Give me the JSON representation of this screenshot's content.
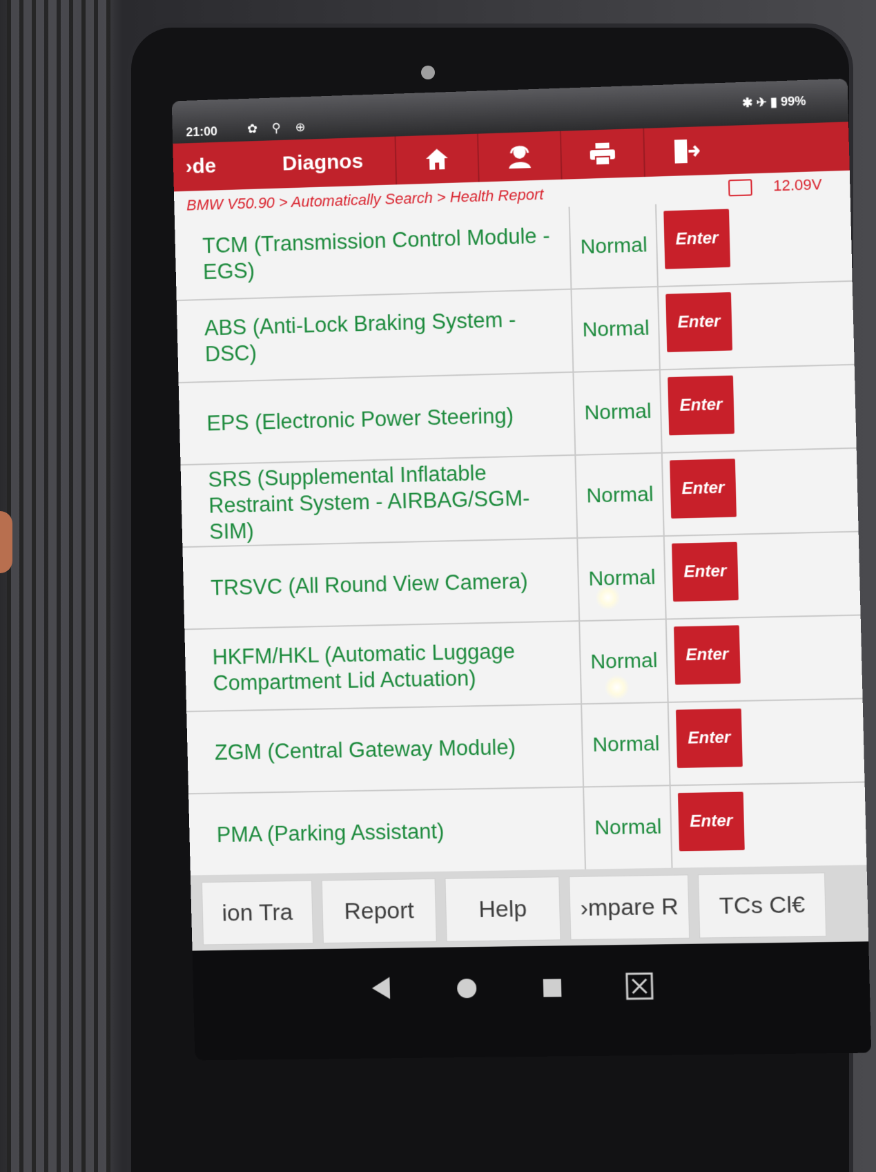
{
  "status_bar": {
    "time": "21:00",
    "left_icons": "✿ ⚲ ⊕",
    "right_icons": "✱ ✈",
    "battery": "99%"
  },
  "app_bar": {
    "mode_label": "›de",
    "title": "Diagnos",
    "nav_icons": [
      "home-icon",
      "support-icon",
      "print-icon",
      "exit-icon"
    ]
  },
  "breadcrumb": {
    "path": "BMW V50.90 > Automatically Search > Health Report",
    "voltage": "12.09V"
  },
  "modules": [
    {
      "name": "TCM (Transmission Control Module - EGS)",
      "status": "Normal",
      "action": "Enter"
    },
    {
      "name": "ABS (Anti-Lock Braking System - DSC)",
      "status": "Normal",
      "action": "Enter"
    },
    {
      "name": "EPS (Electronic Power Steering)",
      "status": "Normal",
      "action": "Enter"
    },
    {
      "name": "SRS (Supplemental Inflatable Restraint System - AIRBAG/SGM-SIM)",
      "status": "Normal",
      "action": "Enter"
    },
    {
      "name": "TRSVC (All Round View Camera)",
      "status": "Normal",
      "action": "Enter"
    },
    {
      "name": "HKFM/HKL (Automatic Luggage Compartment Lid Actuation)",
      "status": "Normal",
      "action": "Enter"
    },
    {
      "name": "ZGM (Central Gateway Module)",
      "status": "Normal",
      "action": "Enter"
    },
    {
      "name": "PMA (Parking Assistant)",
      "status": "Normal",
      "action": "Enter"
    }
  ],
  "footer": {
    "buttons": [
      "ion     Tra",
      "Report",
      "Help",
      "›mpare R",
      "TCs     Cl€"
    ]
  },
  "system_nav": {
    "icons": [
      "back-icon",
      "home-circle-icon",
      "recents-icon",
      "screenshot-icon"
    ]
  },
  "colors": {
    "brand_red": "#c0222b",
    "text_green": "#1c8a3c",
    "row_bg": "#f3f3f3"
  }
}
